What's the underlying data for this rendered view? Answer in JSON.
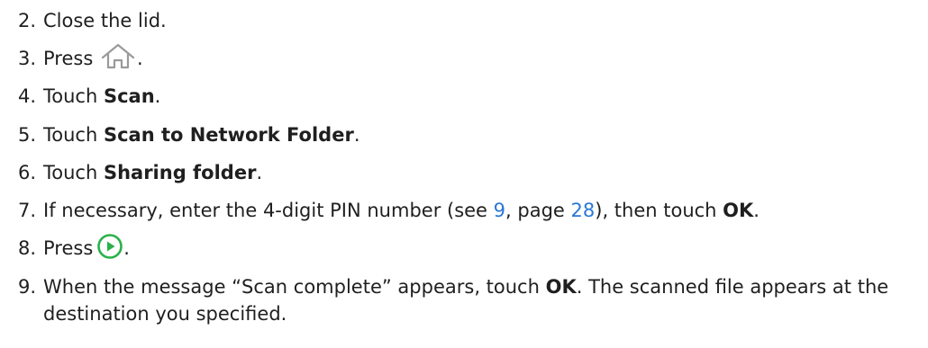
{
  "steps": [
    {
      "num": "2.",
      "text": "Close the lid."
    },
    {
      "num": "3.",
      "pre": "Press",
      "icon": "home-icon",
      "post": "."
    },
    {
      "num": "4.",
      "pre": "Touch ",
      "bold": "Scan",
      "post": "."
    },
    {
      "num": "5.",
      "pre": "Touch ",
      "bold": "Scan to Network Folder",
      "post": "."
    },
    {
      "num": "6.",
      "pre": "Touch ",
      "bold": "Sharing folder",
      "post": "."
    },
    {
      "num": "7.",
      "pre": "If necessary, enter the 4-digit PIN number (see ",
      "link1": "9",
      "mid": ", page ",
      "link2": "28",
      "mid2": "), then touch ",
      "bold": "OK",
      "post": "."
    },
    {
      "num": "8.",
      "pre": "Press",
      "icon": "play-icon",
      "post": "."
    },
    {
      "num": "9.",
      "pre": "When the message “Scan complete” appears, touch ",
      "bold": "OK",
      "post": ". The scanned file appears at the destination you specified."
    }
  ],
  "colors": {
    "text": "#1f1f1f",
    "link": "#2a78d6",
    "play_icon": "#2bb14a",
    "home_icon": "#9a9a9a"
  }
}
